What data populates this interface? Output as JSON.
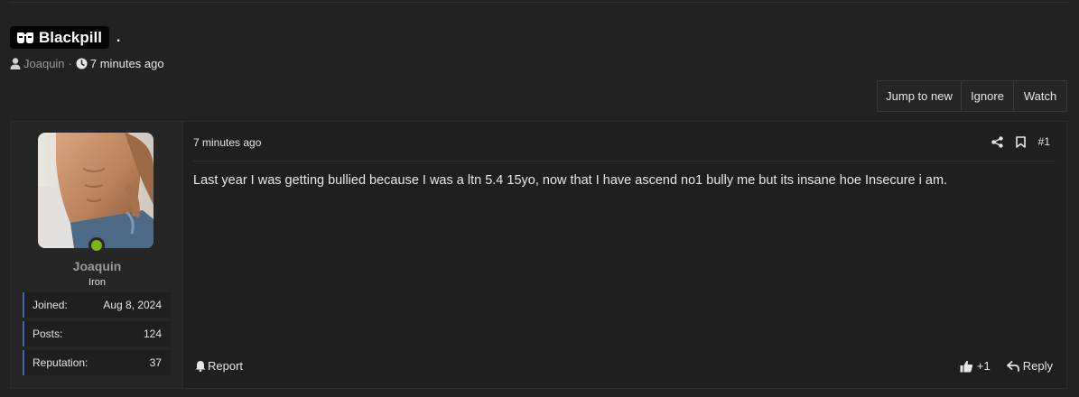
{
  "thread": {
    "prefix_label": "Blackpill",
    "prefix_icon": "mask-icon",
    "title": ".",
    "author": "Joaquin",
    "separator": "·",
    "time": "7 minutes ago"
  },
  "actions": {
    "jump_to_new": "Jump to new",
    "ignore": "Ignore",
    "watch": "Watch"
  },
  "post": {
    "user": {
      "name": "Joaquin",
      "title": "Iron",
      "online": true,
      "stats": [
        {
          "label": "Joined:",
          "value": "Aug 8, 2024"
        },
        {
          "label": "Posts:",
          "value": "124"
        },
        {
          "label": "Reputation:",
          "value": "37"
        }
      ]
    },
    "date": "7 minutes ago",
    "number": "#1",
    "body": "Last year I was getting bullied because I was a ltn 5.4 15yo, now that I have ascend no1 bully me but its insane hoe Insecure i am.",
    "report_label": "Report",
    "like_count": "+1",
    "reply_label": "Reply"
  },
  "colors": {
    "background": "#222222",
    "prefix_bg": "#050505",
    "online": "#7cb518",
    "stat_accent": "#4f5db5"
  }
}
